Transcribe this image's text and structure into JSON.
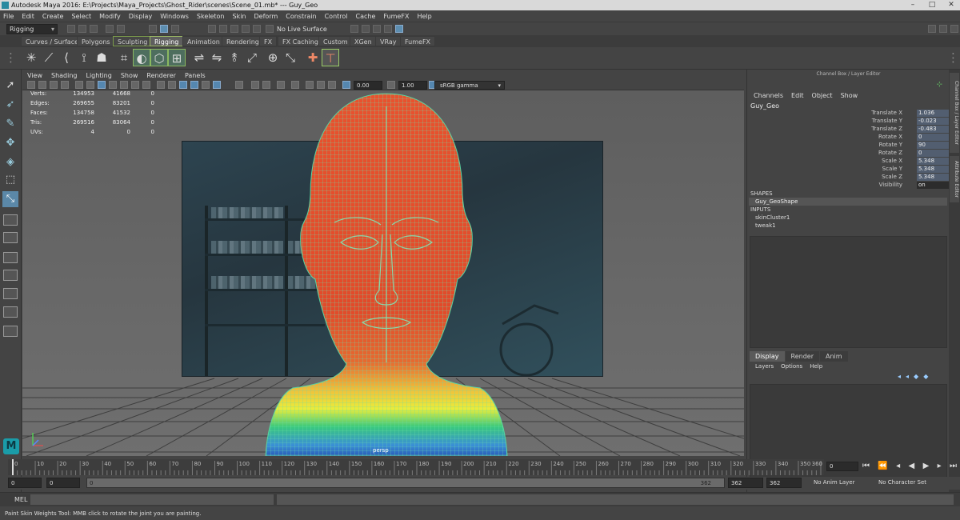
{
  "window": {
    "title": "Autodesk Maya 2016: E:\\Projects\\Maya_Projects\\Ghost_Rider\\scenes\\Scene_01.mb* --- Guy_Geo"
  },
  "menu": [
    "File",
    "Edit",
    "Create",
    "Select",
    "Modify",
    "Display",
    "Windows",
    "Skeleton",
    "Skin",
    "Deform",
    "Constrain",
    "Control",
    "Cache",
    "FumeFX",
    "Help"
  ],
  "status_line": {
    "menu_set": "Rigging",
    "live_surface": "No Live Surface"
  },
  "shelf_tabs": [
    "Curves / Surfaces",
    "Polygons",
    "Sculpting",
    "Rigging",
    "Animation",
    "Rendering",
    "FX",
    "FX Caching",
    "Custom",
    "XGen",
    "VRay",
    "FumeFX"
  ],
  "shelf_active_tab": "Rigging",
  "viewport": {
    "menu": [
      "View",
      "Shading",
      "Lighting",
      "Show",
      "Renderer",
      "Panels"
    ],
    "exposure": "0.00",
    "gamma": "1.00",
    "color_space": "sRGB gamma",
    "camera_label": "persp",
    "hud": [
      {
        "label": "Verts:",
        "a": "134953",
        "b": "41668",
        "c": "0"
      },
      {
        "label": "Edges:",
        "a": "269655",
        "b": "83201",
        "c": "0"
      },
      {
        "label": "Faces:",
        "a": "134758",
        "b": "41532",
        "c": "0"
      },
      {
        "label": "Tris:",
        "a": "269516",
        "b": "83064",
        "c": "0"
      },
      {
        "label": "UVs:",
        "a": "4",
        "b": "0",
        "c": "0"
      }
    ]
  },
  "channel_box": {
    "header": "Channel Box / Layer Editor",
    "menu": [
      "Channels",
      "Edit",
      "Object",
      "Show"
    ],
    "object": "Guy_Geo",
    "attributes": [
      {
        "name": "Translate X",
        "value": "1.036"
      },
      {
        "name": "Translate Y",
        "value": "-0.023"
      },
      {
        "name": "Translate Z",
        "value": "-0.483"
      },
      {
        "name": "Rotate X",
        "value": "0"
      },
      {
        "name": "Rotate Y",
        "value": "90"
      },
      {
        "name": "Rotate Z",
        "value": "0"
      },
      {
        "name": "Scale X",
        "value": "5.348"
      },
      {
        "name": "Scale Y",
        "value": "5.348"
      },
      {
        "name": "Scale Z",
        "value": "5.348"
      },
      {
        "name": "Visibility",
        "value": "on"
      }
    ],
    "shapes_label": "SHAPES",
    "shape": "Guy_GeoShape",
    "inputs_label": "INPUTS",
    "inputs": [
      "skinCluster1",
      "tweak1"
    ]
  },
  "layer_editor": {
    "tabs": [
      "Display",
      "Render",
      "Anim"
    ],
    "menu": [
      "Layers",
      "Options",
      "Help"
    ]
  },
  "side_tabs": [
    "Channel Box / Layer Editor",
    "Attribute Editor"
  ],
  "time_slider": {
    "ticks": [
      "0",
      "10",
      "20",
      "30",
      "40",
      "50",
      "60",
      "70",
      "80",
      "90",
      "100",
      "110",
      "120",
      "130",
      "140",
      "150",
      "160",
      "170",
      "180",
      "190",
      "200",
      "210",
      "220",
      "230",
      "240",
      "250",
      "260",
      "270",
      "280",
      "290",
      "300",
      "310",
      "320",
      "330",
      "340",
      "350",
      "360"
    ],
    "current_frame": "0",
    "playhead_frame": "0"
  },
  "range_slider": {
    "start": "0",
    "anim_start": "0",
    "range_start": "0",
    "range_end": "362",
    "anim_end": "362",
    "end": "362",
    "anim_layer": "No Anim Layer",
    "character_set": "No Character Set"
  },
  "command_line": {
    "language": "MEL"
  },
  "help_line": "Paint Skin Weights Tool: MMB click to rotate the joint you are painting."
}
